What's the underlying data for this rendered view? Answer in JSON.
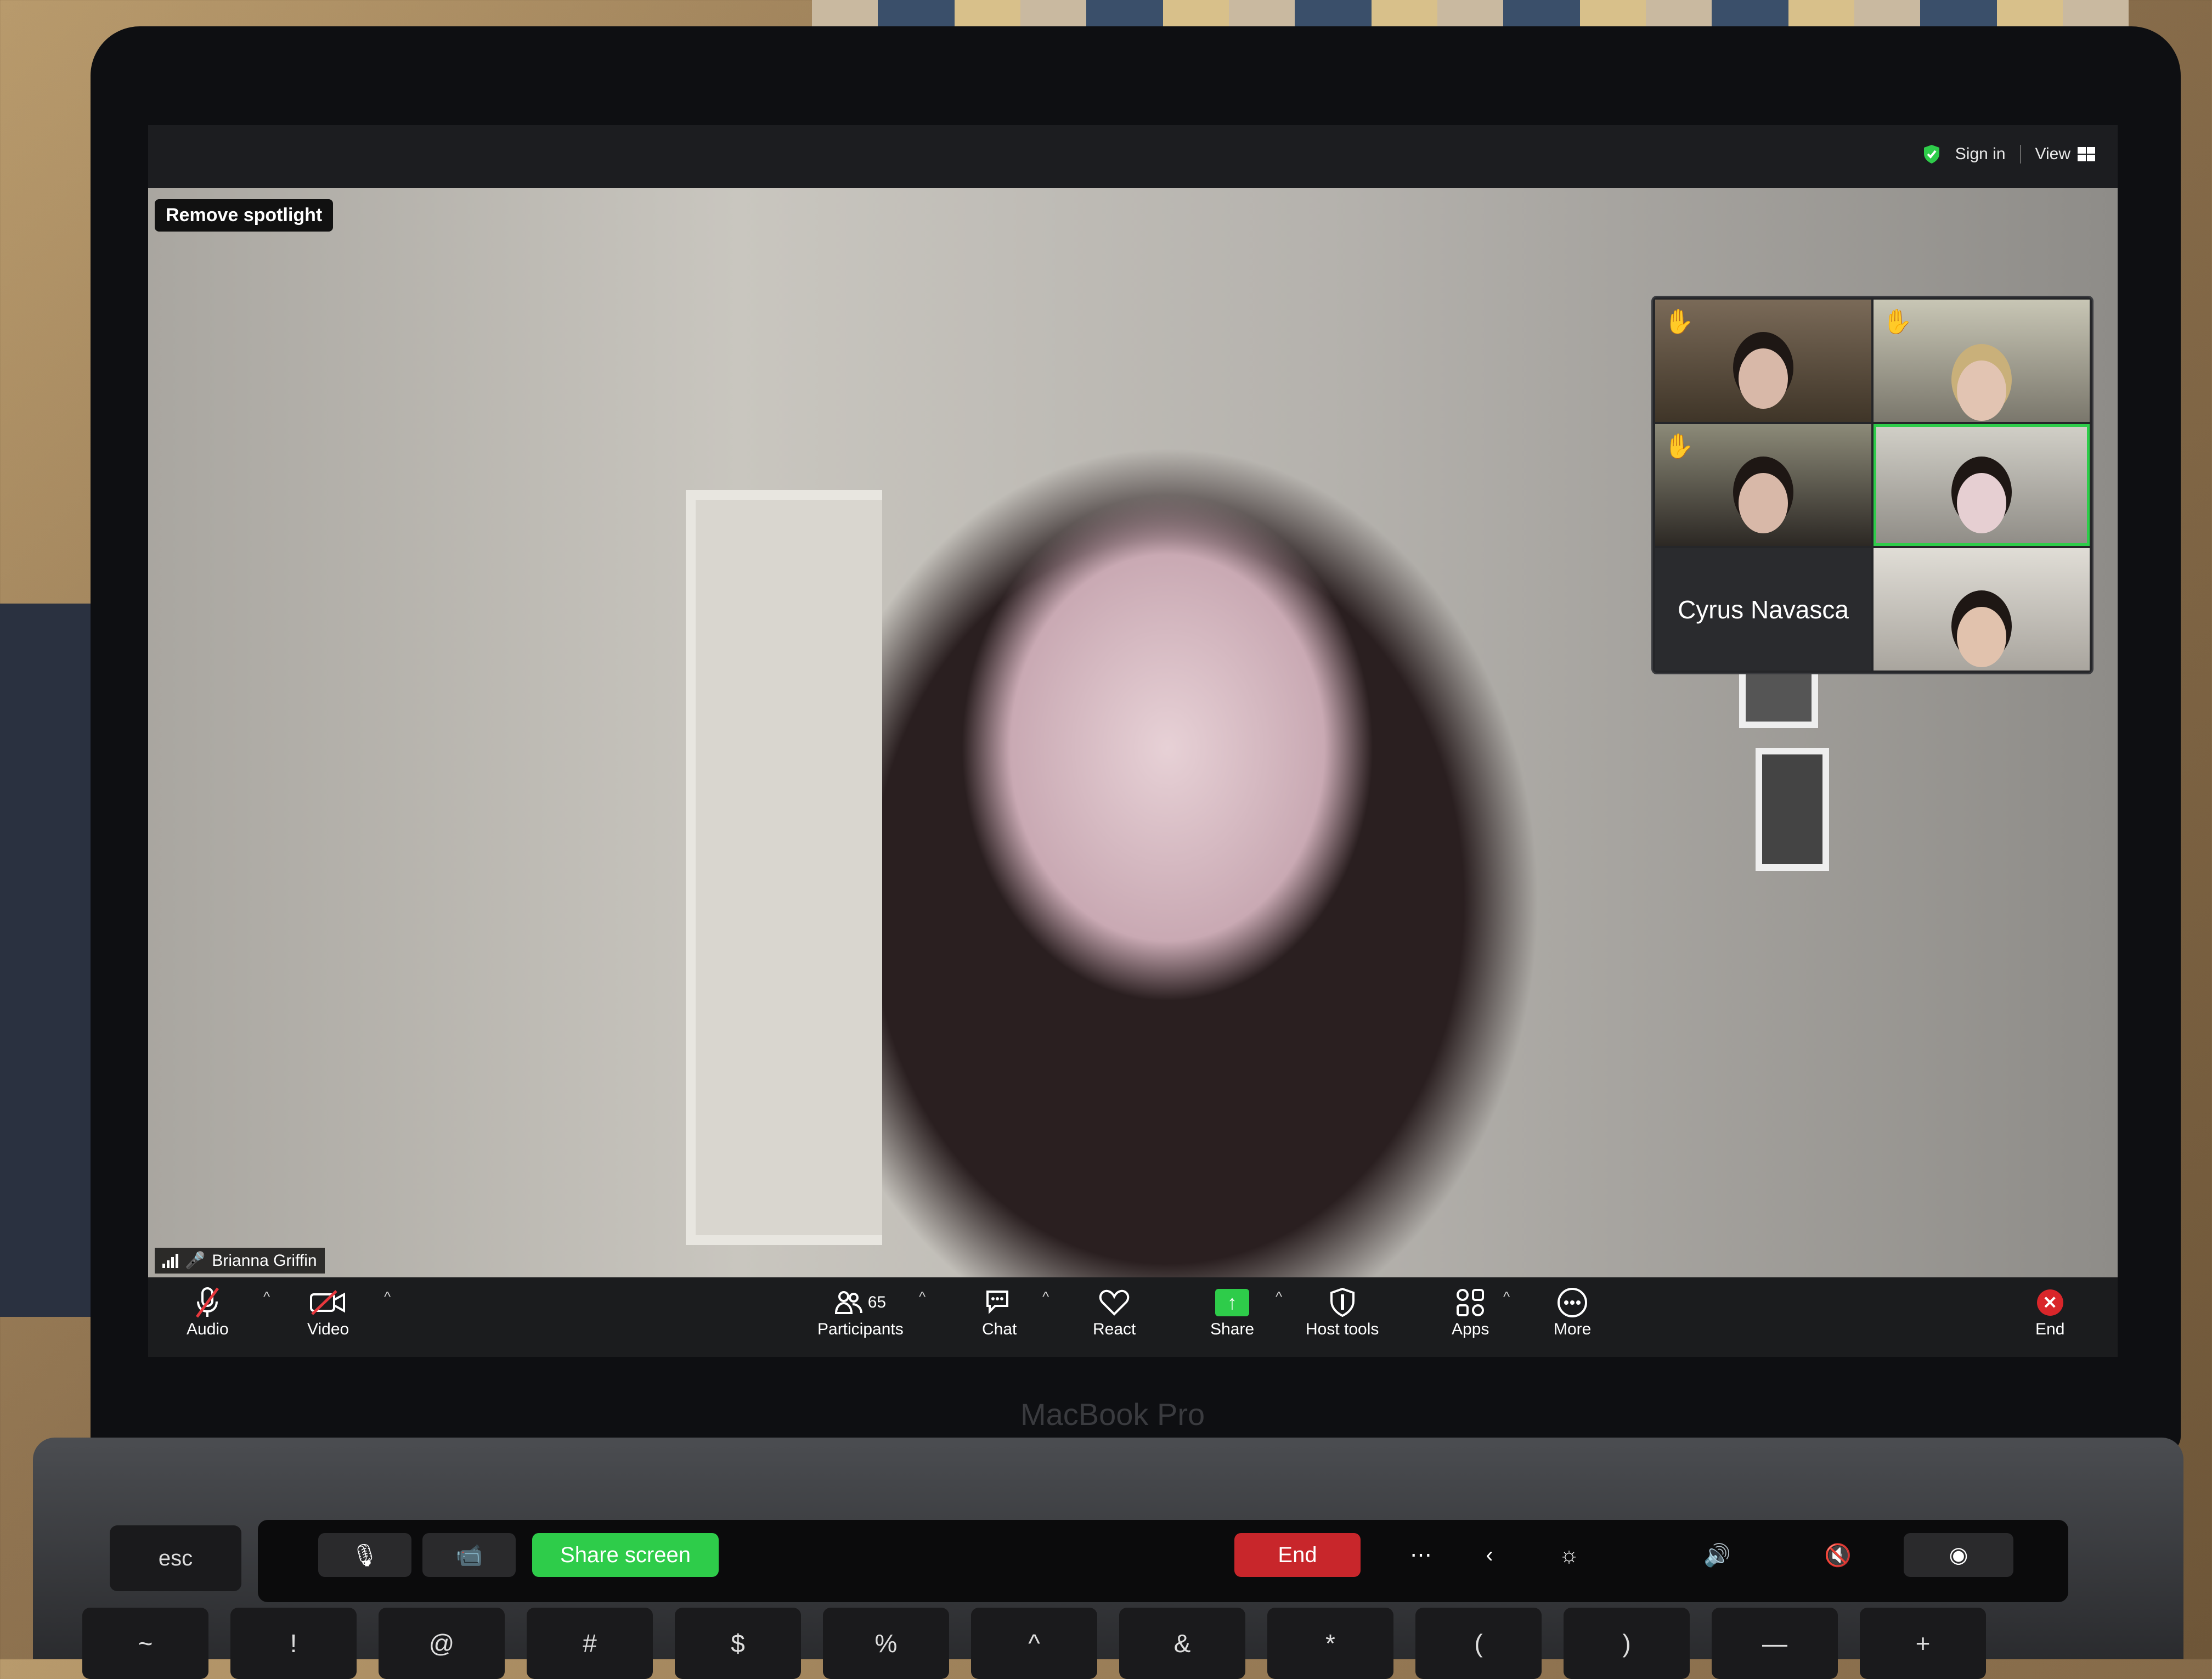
{
  "window": {
    "sign_in": "Sign in",
    "view": "View"
  },
  "spotlight": {
    "remove_label": "Remove spotlight"
  },
  "main_video": {
    "participant_name": "Brianna Griffin"
  },
  "thumbnails": [
    {
      "name": "",
      "hand_raised": true
    },
    {
      "name": "",
      "hand_raised": true
    },
    {
      "name": "",
      "hand_raised": true
    },
    {
      "name": "",
      "hand_raised": false,
      "active_speaker": true
    },
    {
      "name": "Cyrus Navasca",
      "hand_raised": false,
      "video_off": true
    },
    {
      "name": "",
      "hand_raised": false
    }
  ],
  "toolbar": {
    "audio": "Audio",
    "video": "Video",
    "participants": "Participants",
    "participants_count": "65",
    "chat": "Chat",
    "react": "React",
    "share": "Share",
    "host_tools": "Host tools",
    "apps": "Apps",
    "more": "More",
    "end": "End"
  },
  "device": {
    "brand": "MacBook Pro"
  },
  "touch_bar": {
    "esc": "esc",
    "share_screen": "Share screen",
    "end": "End"
  },
  "keyboard_row": [
    "~",
    "!",
    "@",
    "#",
    "$",
    "%",
    "^",
    "&",
    "*",
    "(",
    ")",
    "—",
    "+"
  ],
  "colors": {
    "share_green": "#2ecc4a",
    "end_red": "#d9262a",
    "active_speaker_border": "#2ecc4a",
    "toolbar_bg": "#1b1c1e"
  },
  "icons": {
    "audio": "muted-microphone-icon",
    "video": "video-off-icon",
    "participants": "people-icon",
    "chat": "chat-bubble-icon",
    "react": "heart-icon",
    "share": "share-arrow-icon",
    "host_tools": "shield-icon",
    "apps": "apps-icon",
    "more": "ellipsis-icon",
    "end": "close-icon"
  }
}
